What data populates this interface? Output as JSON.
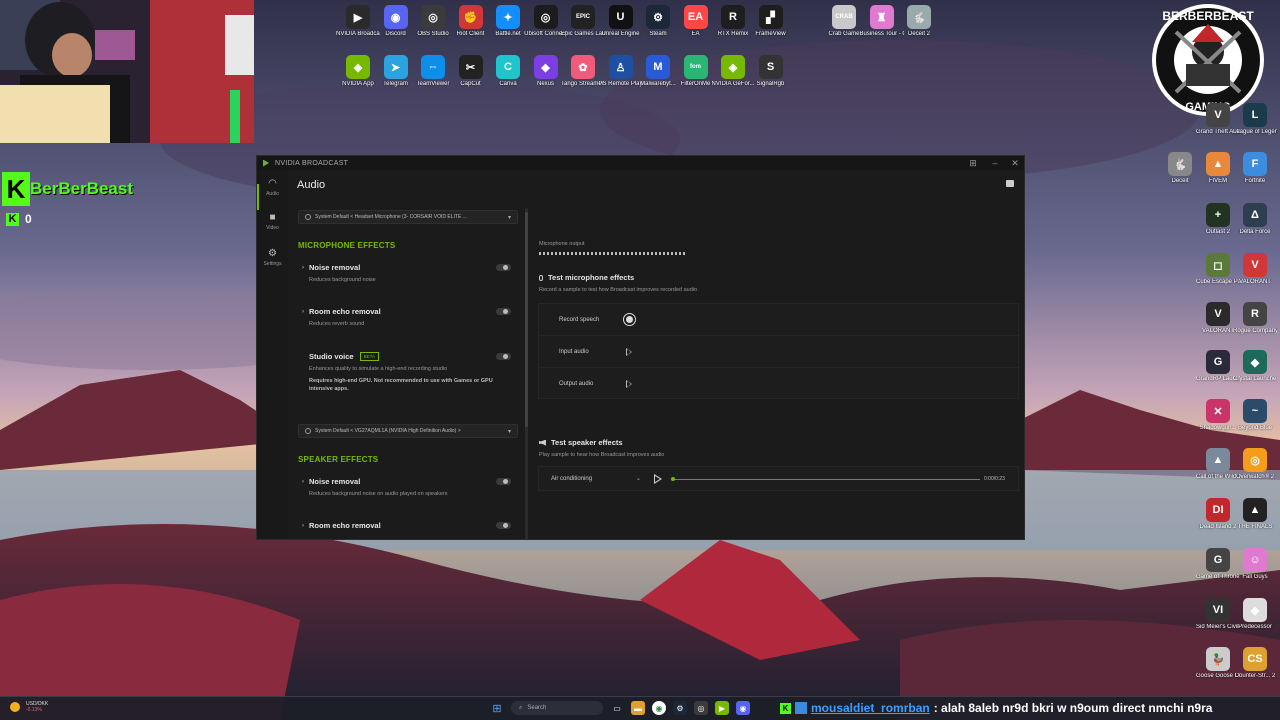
{
  "stream_overlay": {
    "channel_name": "BerBerBeast",
    "kick_letter": "K",
    "viewer_count": "0",
    "logo_top_text": "BERBERBEAST",
    "logo_bottom_text": "GAMING"
  },
  "desktop_icons_top_row1": [
    {
      "label": "NVIDIA Broadcast",
      "color": "#2a2a2a",
      "glyph": "▶",
      "icon": "nvidia-broadcast-icon"
    },
    {
      "label": "Discord",
      "color": "#5865f2",
      "glyph": "◉",
      "icon": "discord-icon"
    },
    {
      "label": "OBS Studio",
      "color": "#3b3b3b",
      "glyph": "◎",
      "icon": "obs-icon"
    },
    {
      "label": "Riot Client",
      "color": "#d13639",
      "glyph": "✊",
      "icon": "riot-icon"
    },
    {
      "label": "Battle.net",
      "color": "#148eff",
      "glyph": "✦",
      "icon": "battlenet-icon"
    },
    {
      "label": "Ubisoft Connect",
      "color": "#1c1c1c",
      "glyph": "◎",
      "icon": "ubisoft-icon"
    },
    {
      "label": "Epic Games Launcher",
      "color": "#222",
      "glyph": "EPIC",
      "icon": "epic-icon"
    },
    {
      "label": "Unreal Engine",
      "color": "#111",
      "glyph": "U",
      "icon": "unreal-icon"
    },
    {
      "label": "Steam",
      "color": "#1b2838",
      "glyph": "⚙",
      "icon": "steam-icon"
    },
    {
      "label": "EA",
      "color": "#ff4747",
      "glyph": "EA",
      "icon": "ea-icon"
    },
    {
      "label": "RTX Remix",
      "color": "#1e1e1e",
      "glyph": "R",
      "icon": "rtx-remix-icon"
    },
    {
      "label": "FrameView",
      "color": "#1e1e1e",
      "glyph": "▞",
      "icon": "frameview-icon"
    }
  ],
  "desktop_icons_top_row2": [
    {
      "label": "NVIDIA App",
      "color": "#76b900",
      "glyph": "◈",
      "icon": "nvidia-app-icon"
    },
    {
      "label": "Telegram",
      "color": "#2aa3df",
      "glyph": "➤",
      "icon": "telegram-icon"
    },
    {
      "label": "TeamViewer",
      "color": "#0e8ee9",
      "glyph": "⇔",
      "icon": "teamviewer-icon"
    },
    {
      "label": "CapCut",
      "color": "#222",
      "glyph": "✂",
      "icon": "capcut-icon"
    },
    {
      "label": "Canva",
      "color": "#20c4cb",
      "glyph": "C",
      "icon": "canva-icon"
    },
    {
      "label": "Nexus",
      "color": "#7b3fe4",
      "glyph": "◆",
      "icon": "nexus-icon"
    },
    {
      "label": "Tango Streamer...",
      "color": "#f25a7a",
      "glyph": "✿",
      "icon": "tango-icon"
    },
    {
      "label": "PS Remote Play",
      "color": "#1e4fa0",
      "glyph": "♙",
      "icon": "ps-remote-icon"
    },
    {
      "label": "Malwarebyt...",
      "color": "#2a5bd7",
      "glyph": "M",
      "icon": "malwarebytes-icon"
    },
    {
      "label": "FilterOnMe",
      "color": "#2bb673",
      "glyph": "fom",
      "icon": "filteronme-icon"
    },
    {
      "label": "NVIDIA GeFor...",
      "color": "#76b900",
      "glyph": "◈",
      "icon": "geforce-icon"
    },
    {
      "label": "SignalRgb",
      "color": "#333",
      "glyph": "S",
      "icon": "signalrgb-icon"
    }
  ],
  "desktop_icons_top_extra": [
    {
      "label": "Crab Game",
      "color": "#c9c9c9",
      "glyph": "CRAB",
      "icon": "crab-game-icon"
    },
    {
      "label": "Business Tour - Onli...",
      "color": "#e07ad0",
      "glyph": "♜",
      "icon": "business-tour-icon"
    },
    {
      "label": "Deceit 2",
      "color": "#9aa",
      "glyph": "🐇",
      "icon": "deceit-icon"
    }
  ],
  "desktop_icons_right": [
    {
      "label": "Grand Theft Auto V En...",
      "color": "#444",
      "glyph": "V",
      "icon": "gta-icon"
    },
    {
      "label": "League of Legends",
      "color": "#1c3b4a",
      "glyph": "L",
      "icon": "lol-icon"
    },
    {
      "label": "Deceit",
      "color": "#888",
      "glyph": "🐇",
      "icon": "deceit-2-icon"
    },
    {
      "label": "FIVEM",
      "color": "#e8883a",
      "glyph": "▲",
      "icon": "fivem-icon"
    },
    {
      "label": "Fortnite",
      "color": "#3c8de0",
      "glyph": "F",
      "icon": "fortnite-icon"
    },
    {
      "label": "Outlast 2",
      "color": "#223322",
      "glyph": "+",
      "icon": "outlast-icon"
    },
    {
      "label": "Delta Force",
      "color": "#2c3e50",
      "glyph": "Δ",
      "icon": "delta-force-icon"
    },
    {
      "label": "Cube Escape Paradox",
      "color": "#5a7a3a",
      "glyph": "◻",
      "icon": "cube-escape-icon"
    },
    {
      "label": "VALORANT",
      "color": "#d13639",
      "glyph": "V",
      "icon": "valorant-icon"
    },
    {
      "label": "VALORANT",
      "color": "#2a2a2a",
      "glyph": "V",
      "icon": "valorant-2-icon"
    },
    {
      "label": "Rogue Company",
      "color": "#444",
      "glyph": "R",
      "icon": "rogue-company-icon"
    },
    {
      "label": "GrandRP Launcher",
      "color": "#2a2a3a",
      "glyph": "G",
      "icon": "grandrp-icon"
    },
    {
      "label": "Crystal Launcher",
      "color": "#1d6a5a",
      "glyph": "◆",
      "icon": "crystal-icon"
    },
    {
      "label": "Shadowgun...",
      "color": "#c9356a",
      "glyph": "✕",
      "icon": "shadowgun-icon"
    },
    {
      "label": "Beyond Blue",
      "color": "#2a4b6a",
      "glyph": "~",
      "icon": "beyond-blue-icon"
    },
    {
      "label": "Call of the Wild Th...",
      "color": "#7a8a9a",
      "glyph": "▲",
      "icon": "cotw-icon"
    },
    {
      "label": "Overwatch® 2",
      "color": "#f59d1a",
      "glyph": "◎",
      "icon": "overwatch-icon"
    },
    {
      "label": "Dead Island 2",
      "color": "#c0282d",
      "glyph": "DI",
      "icon": "dead-island-icon"
    },
    {
      "label": "THE FINALS",
      "color": "#222",
      "glyph": "▲",
      "icon": "the-finals-icon"
    },
    {
      "label": "Game of Thrones...",
      "color": "#444",
      "glyph": "G",
      "icon": "got-icon"
    },
    {
      "label": "Fall Guys",
      "color": "#e07ad0",
      "glyph": "☺",
      "icon": "fall-guys-icon"
    },
    {
      "label": "Sid Meier's Civilization VI",
      "color": "#333",
      "glyph": "VI",
      "icon": "civ-icon"
    },
    {
      "label": "Predecessor",
      "color": "#ddd",
      "glyph": "◈",
      "icon": "predecessor-icon"
    },
    {
      "label": "Goose Goose Duck",
      "color": "#ccc",
      "glyph": "🦆",
      "icon": "ggd-icon"
    },
    {
      "label": "Counter-Str... 2",
      "color": "#e0a030",
      "glyph": "CS",
      "icon": "cs2-icon"
    }
  ],
  "app": {
    "window_title": "NVIDIA BROADCAST",
    "page_title": "Audio",
    "nav": [
      {
        "label": "Audio",
        "glyph": "◠"
      },
      {
        "label": "Video",
        "glyph": "■"
      },
      {
        "label": "Settings",
        "glyph": "⚙"
      }
    ],
    "mic_device": "System Default < Headset Microphone (3- CORSAIR VOID ELITE ...",
    "mic_effects_heading": "MICROPHONE EFFECTS",
    "mic_effects": [
      {
        "name": "Noise removal",
        "desc": "Reduces background noise"
      },
      {
        "name": "Room echo removal",
        "desc": "Reduces reverb sound"
      }
    ],
    "studio_voice": {
      "name": "Studio voice",
      "badge": "BETA",
      "desc": "Enhances quality to simulate a high-end recording studio",
      "warning": "Requires high-end GPU. Not recommended to use with Games or GPU intensive apps."
    },
    "speaker_device": "System Default < VG27AQML1A (NVIDIA High Definition Audio) >",
    "speaker_effects_heading": "SPEAKER EFFECTS",
    "speaker_effects": [
      {
        "name": "Noise removal",
        "desc": "Reduces background noise on audio played on speakers"
      },
      {
        "name": "Room echo removal",
        "desc": ""
      }
    ],
    "mic_output_label": "Microphone output",
    "test_mic": {
      "heading": "Test microphone effects",
      "desc": "Record a sample to test how Broadcast improves recorded audio",
      "rows": [
        {
          "label": "Record speech"
        },
        {
          "label": "Input audio"
        },
        {
          "label": "Output audio"
        }
      ]
    },
    "test_speaker": {
      "heading": "Test speaker effects",
      "desc": "Play sample to hear how Broadcast improves audio",
      "sample": "Air conditioning",
      "time": "0:00/0:23",
      "progress": 0
    }
  },
  "taskbar": {
    "ticker_symbol": "USD/DKK",
    "ticker_change": "-0.13%",
    "search_placeholder": "Search"
  },
  "chat": {
    "user": "mousaldiet_romrban",
    "message": ": alah 8aleb nr9d bkri w n9oum direct nmchi n9ra"
  }
}
